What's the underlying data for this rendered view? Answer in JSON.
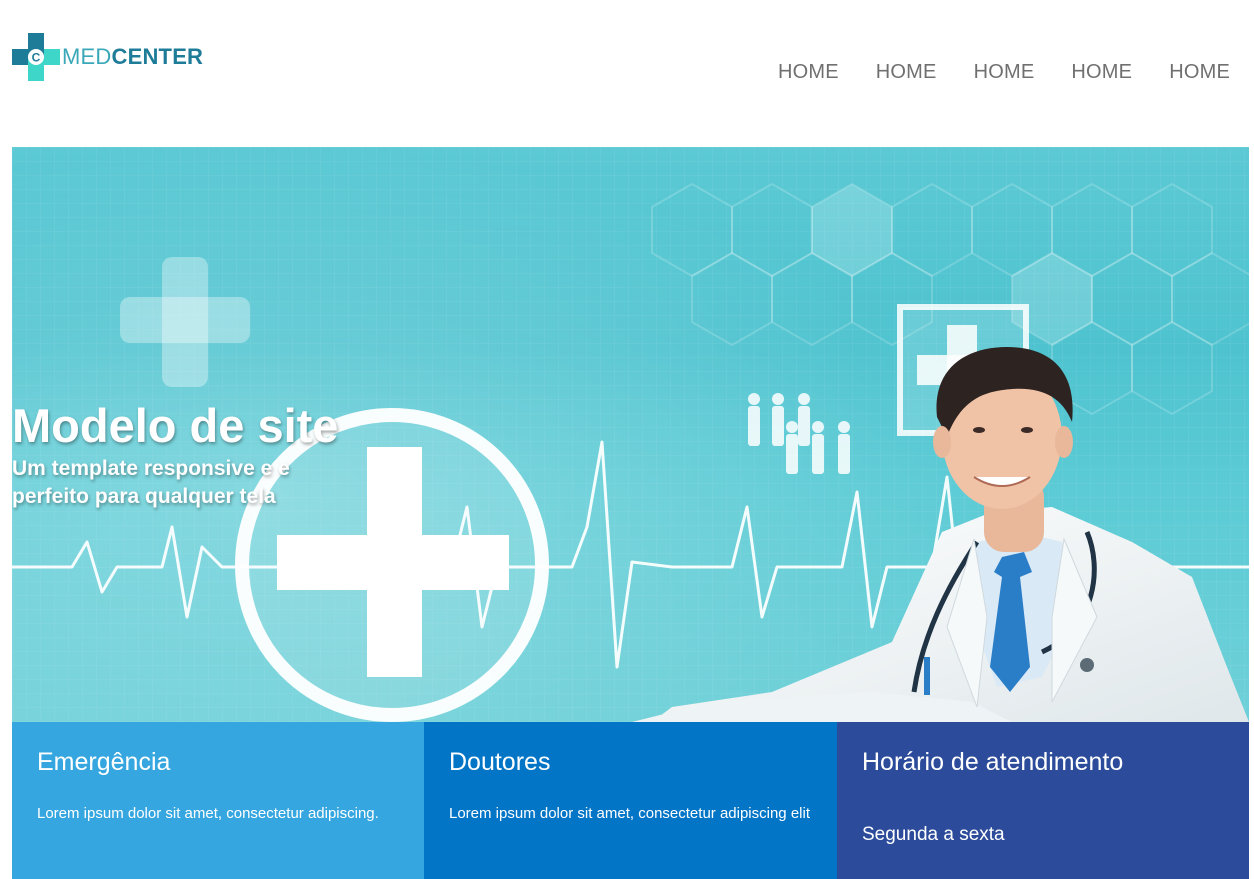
{
  "brand": {
    "mark_letter": "C",
    "name_light": "MED",
    "name_bold": "CENTER",
    "colors": {
      "teal_dark": "#1f7c99",
      "teal_light": "#3ed6c8",
      "text_light": "#3aa8b8"
    }
  },
  "nav": {
    "items": [
      {
        "label": "HOME"
      },
      {
        "label": "HOME"
      },
      {
        "label": "HOME"
      },
      {
        "label": "HOME"
      },
      {
        "label": "HOME"
      }
    ]
  },
  "hero": {
    "title": "Modelo de site",
    "subtitle": "Um template responsive e e perfeito para qualquer tela",
    "image": "doctor-medical-background"
  },
  "features": [
    {
      "title": "Emergência",
      "text": "Lorem ipsum dolor sit amet, consectetur adipiscing.",
      "color": "#35a6df"
    },
    {
      "title": "Doutores",
      "text": "Lorem ipsum dolor sit amet, consectetur adipiscing elit",
      "color": "#0275c6"
    },
    {
      "title": "Horário de atendimento",
      "text": "Segunda a sexta",
      "color": "#2c4c9b"
    }
  ]
}
